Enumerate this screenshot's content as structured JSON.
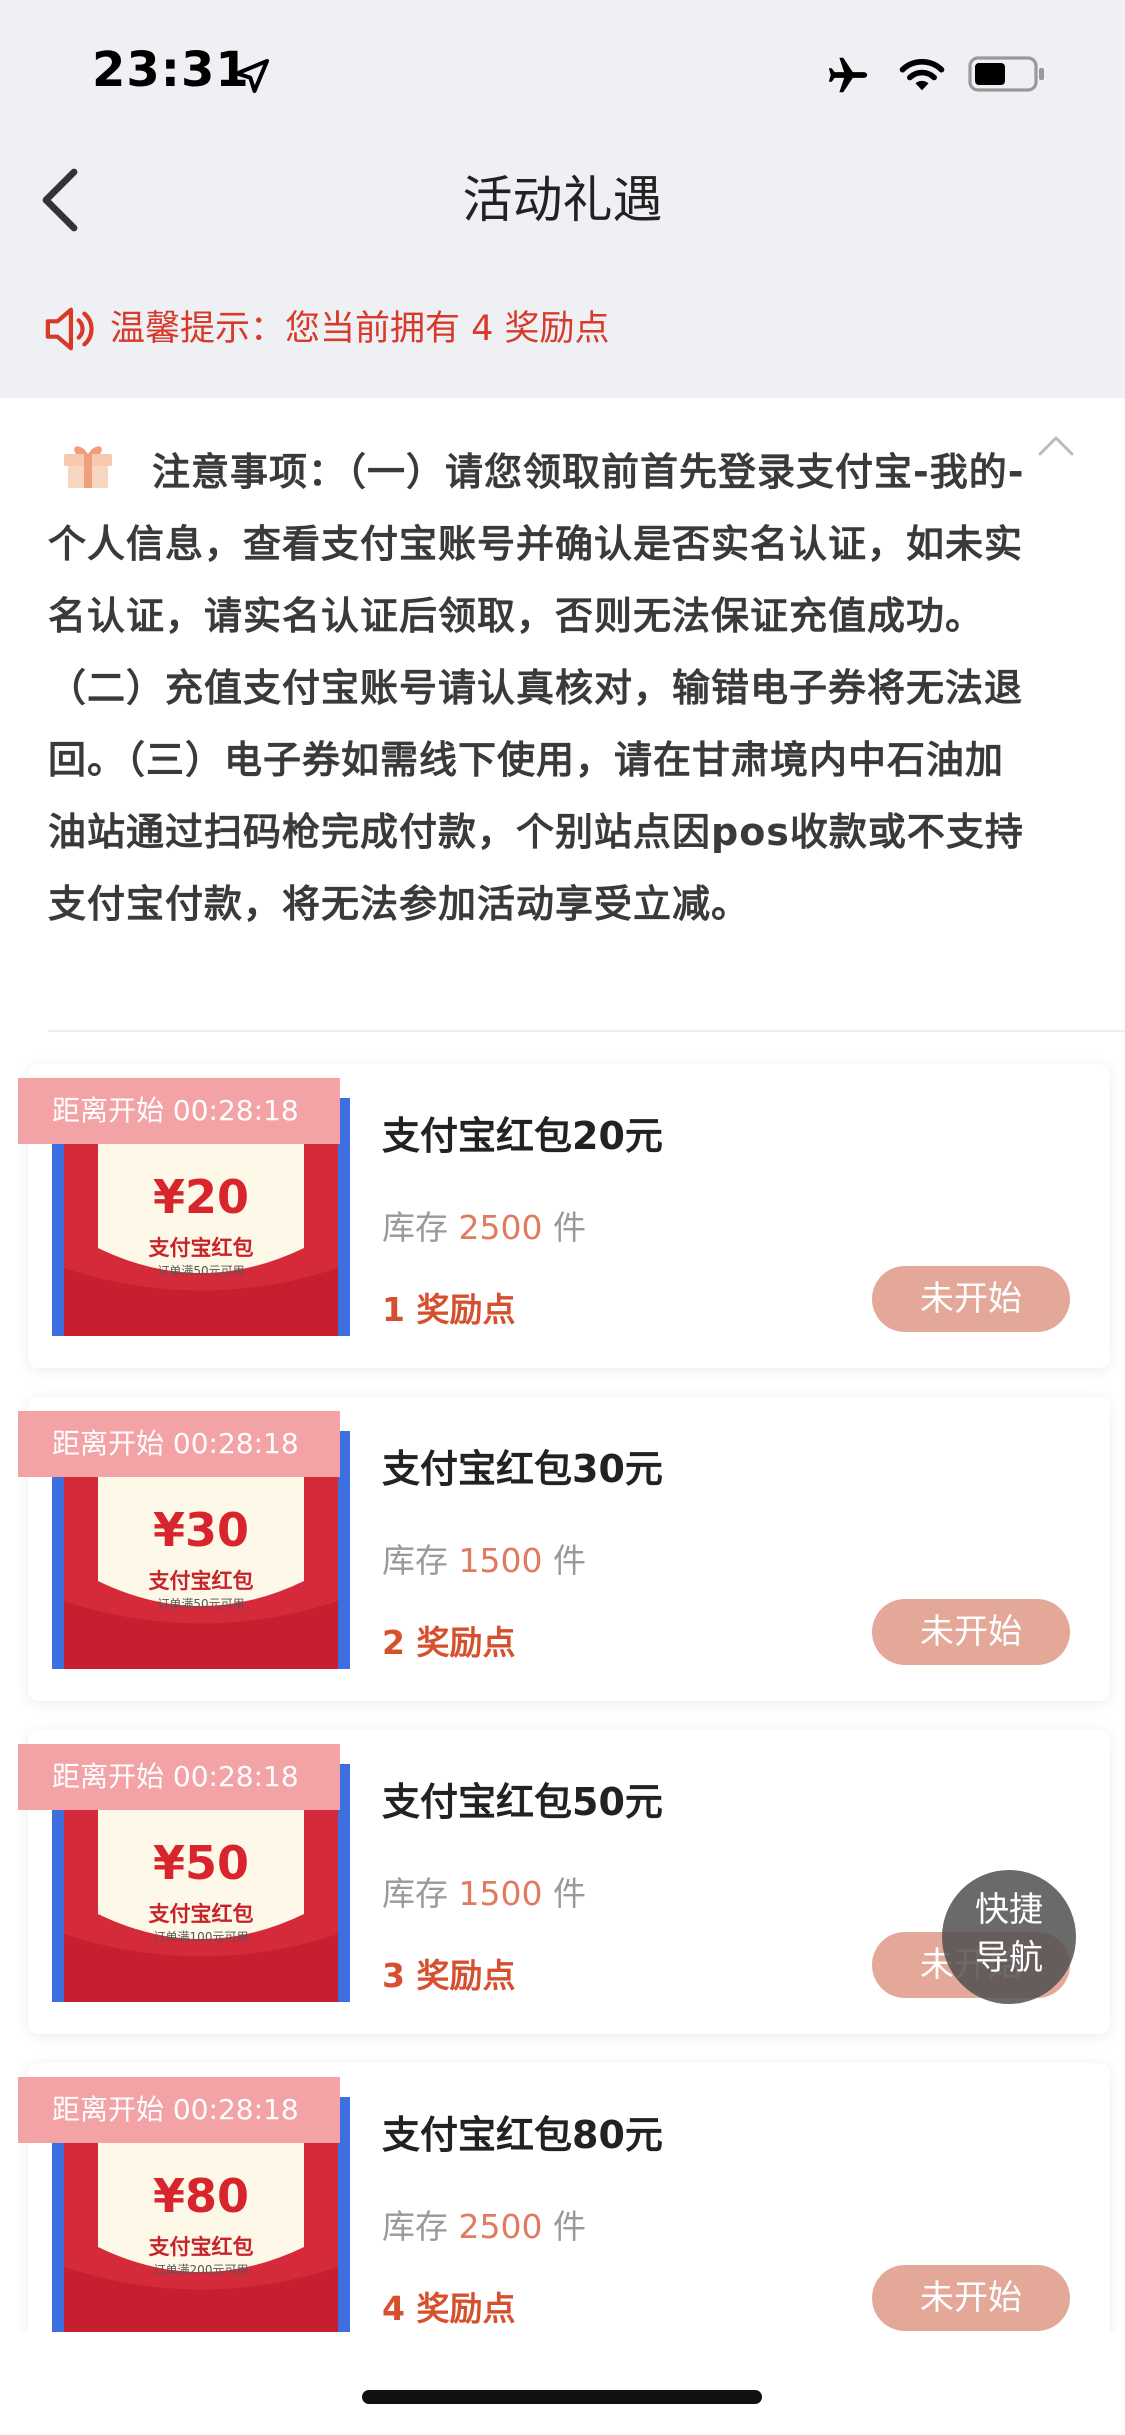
{
  "status_bar": {
    "time": "23:31"
  },
  "nav": {
    "title": "活动礼遇"
  },
  "notice": {
    "text": "温馨提示：您当前拥有 4 奖励点"
  },
  "notes": {
    "text": "注意事项：（一）请您领取前首先登录支付宝-我的-个人信息，查看支付宝账号并确认是否实名认证，如未实名认证，请实名认证后领取，否则无法保证充值成功。（二）充值支付宝账号请认真核对，输错电子券将无法退回。（三）电子券如需线下使用，请在甘肃境内中石油加油站通过扫码枪完成付款，个别站点因pos收款或不支持支付宝付款，将无法参加活动享受立减。"
  },
  "cards": [
    {
      "countdown": "距离开始 00:28:18",
      "thumb_amount": "¥20",
      "thumb_label": "支付宝红包",
      "thumb_sub": "订单满50元可用",
      "title": "支付宝红包20元",
      "stock_label": "库存",
      "stock": "2500",
      "stock_unit": "件",
      "points": "1 奖励点",
      "button": "未开始"
    },
    {
      "countdown": "距离开始 00:28:18",
      "thumb_amount": "¥30",
      "thumb_label": "支付宝红包",
      "thumb_sub": "订单满50元可用",
      "title": "支付宝红包30元",
      "stock_label": "库存",
      "stock": "1500",
      "stock_unit": "件",
      "points": "2 奖励点",
      "button": "未开始"
    },
    {
      "countdown": "距离开始 00:28:18",
      "thumb_amount": "¥50",
      "thumb_label": "支付宝红包",
      "thumb_sub": "订单满100元可用",
      "title": "支付宝红包50元",
      "stock_label": "库存",
      "stock": "1500",
      "stock_unit": "件",
      "points": "3 奖励点",
      "button": "未开始"
    },
    {
      "countdown": "距离开始 00:28:18",
      "thumb_amount": "¥80",
      "thumb_label": "支付宝红包",
      "thumb_sub": "订单满200元可用",
      "title": "支付宝红包80元",
      "stock_label": "库存",
      "stock": "2500",
      "stock_unit": "件",
      "points": "4 奖励点",
      "button": "未开始"
    }
  ],
  "quick_nav": {
    "line1": "快捷",
    "line2": "导航"
  },
  "icons": {
    "location": "location-arrow-icon",
    "airplane": "airplane-icon",
    "wifi": "wifi-icon",
    "battery": "battery-icon",
    "back": "chevron-left-icon",
    "speaker": "speaker-icon",
    "gift": "gift-icon",
    "collapse": "chevron-up-icon"
  },
  "colors": {
    "accent_red": "#d83a2a",
    "button_bg": "#e4a899",
    "countdown_bg": "#f3a2a6",
    "points": "#d6502e"
  }
}
